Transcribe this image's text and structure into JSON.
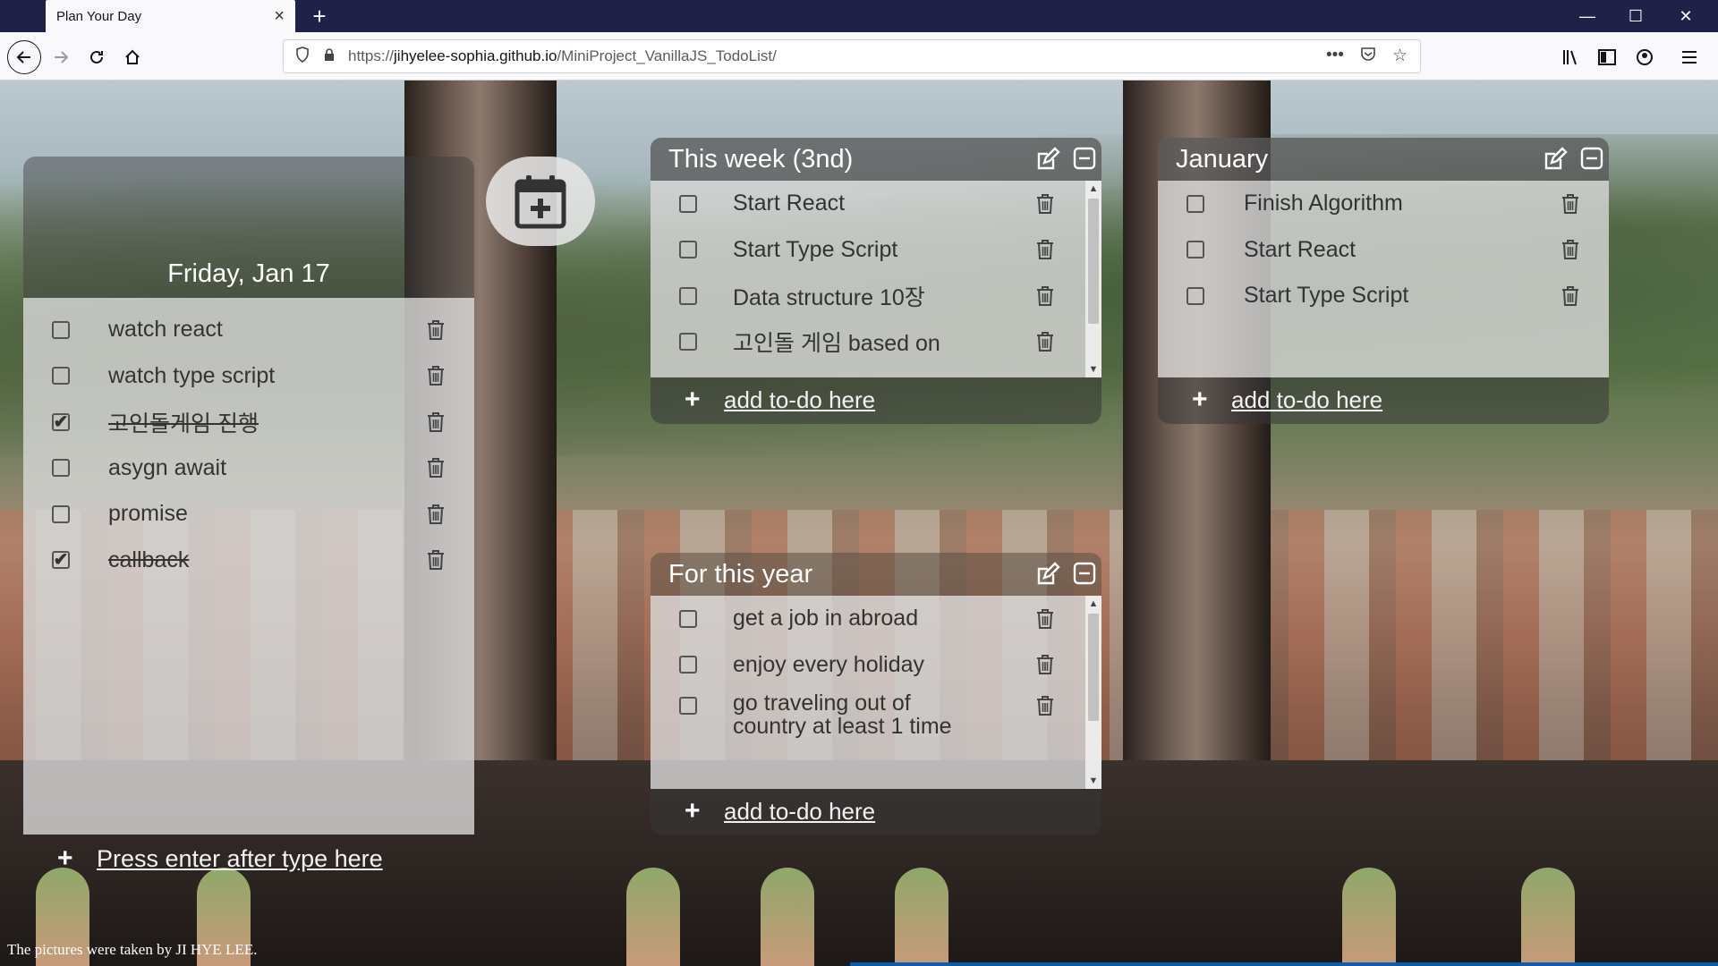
{
  "browser": {
    "tab_title": "Plan Your Day",
    "tab_close": "×",
    "new_tab": "+",
    "url_prefix": "https://",
    "url_host": "jihyelee-sophia.github.io",
    "url_path": "/MiniProject_VanillaJS_TodoList/",
    "window_controls": {
      "minimize": "—",
      "maximize": "☐",
      "close": "✕"
    }
  },
  "day": {
    "title": "Friday, Jan 17",
    "todos": [
      {
        "text": "watch react",
        "done": false
      },
      {
        "text": "watch type script",
        "done": false
      },
      {
        "text": "고인돌게임 진행",
        "done": true
      },
      {
        "text": "asygn await",
        "done": false
      },
      {
        "text": "promise",
        "done": false
      },
      {
        "text": "callback",
        "done": true
      }
    ],
    "add_label": "Press enter after type here"
  },
  "lists": [
    {
      "title": "This week (3nd)",
      "todos": [
        {
          "text": "Start React",
          "done": false
        },
        {
          "text": "Start Type Script",
          "done": false
        },
        {
          "text": "Data structure 10장",
          "done": false
        },
        {
          "text": "고인돌 게임 based on",
          "done": false
        }
      ],
      "add_label": "add to-do here"
    },
    {
      "title": "January",
      "todos": [
        {
          "text": "Finish Algorithm",
          "done": false
        },
        {
          "text": "Start React",
          "done": false
        },
        {
          "text": "Start Type Script",
          "done": false
        }
      ],
      "add_label": "add to-do here"
    },
    {
      "title": "For this year",
      "todos": [
        {
          "text": "get a job in abroad",
          "done": false
        },
        {
          "text": "enjoy every holiday",
          "done": false
        },
        {
          "text": "go traveling out of country at least 1 time",
          "line1": "go traveling out of",
          "line2": "country at least 1 time",
          "done": false
        }
      ],
      "add_label": "add to-do here"
    }
  ],
  "footer": {
    "credit": "The pictures were taken by JI HYE LEE."
  },
  "icons": {
    "checkmark": "✔",
    "plus": "+",
    "trash": "trash-icon",
    "edit": "edit-icon",
    "minimize": "minimize-icon",
    "calendar_add": "calendar-add-icon"
  }
}
